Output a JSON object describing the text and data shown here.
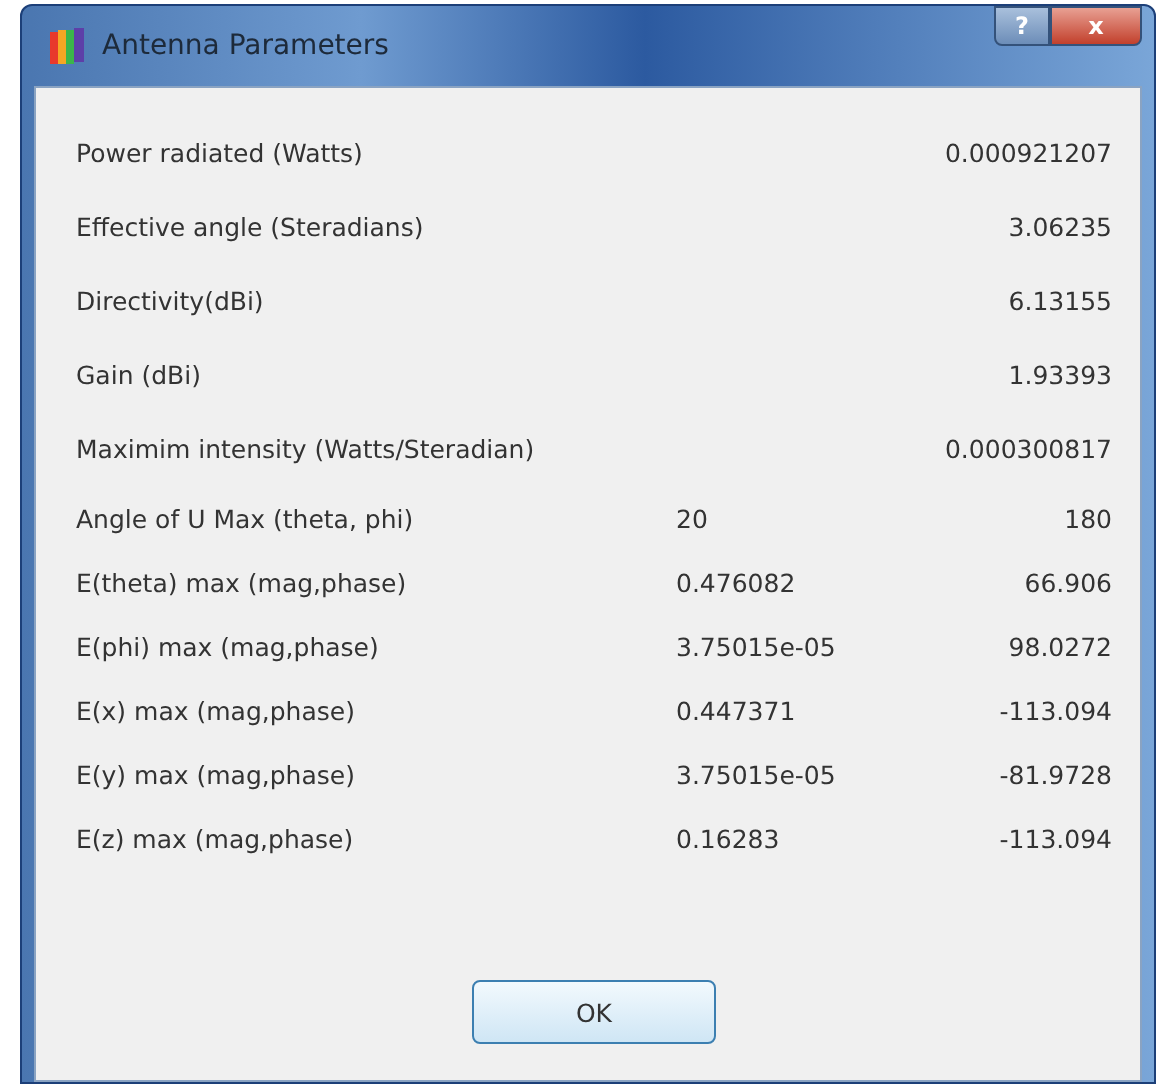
{
  "window": {
    "title": "Antenna Parameters"
  },
  "rows": [
    {
      "kind": "single",
      "label": "Power radiated (Watts)",
      "value": "0.000921207"
    },
    {
      "kind": "single",
      "label": "Effective angle (Steradians)",
      "value": "3.06235"
    },
    {
      "kind": "single",
      "label": "Directivity(dBi)",
      "value": "6.13155"
    },
    {
      "kind": "single",
      "label": "Gain (dBi)",
      "value": "1.93393"
    },
    {
      "kind": "single",
      "label": "Maximim intensity (Watts/Steradian)",
      "value": "0.000300817"
    },
    {
      "kind": "pair",
      "label": "Angle of U Max (theta, phi)",
      "values": [
        "20",
        "180"
      ]
    },
    {
      "kind": "pair",
      "label": "E(theta) max (mag,phase)",
      "values": [
        "0.476082",
        "66.906"
      ]
    },
    {
      "kind": "pair",
      "label": "E(phi) max (mag,phase)",
      "values": [
        "3.75015e-05",
        "98.0272"
      ]
    },
    {
      "kind": "pair",
      "label": "E(x) max (mag,phase)",
      "values": [
        "0.447371",
        "-113.094"
      ]
    },
    {
      "kind": "pair",
      "label": "E(y) max (mag,phase)",
      "values": [
        "3.75015e-05",
        "-81.9728"
      ]
    },
    {
      "kind": "pair",
      "label": "E(z) max (mag,phase)",
      "values": [
        "0.16283",
        "-113.094"
      ]
    }
  ],
  "buttons": [
    "OK"
  ],
  "title_buttons": [
    "?",
    "x"
  ]
}
